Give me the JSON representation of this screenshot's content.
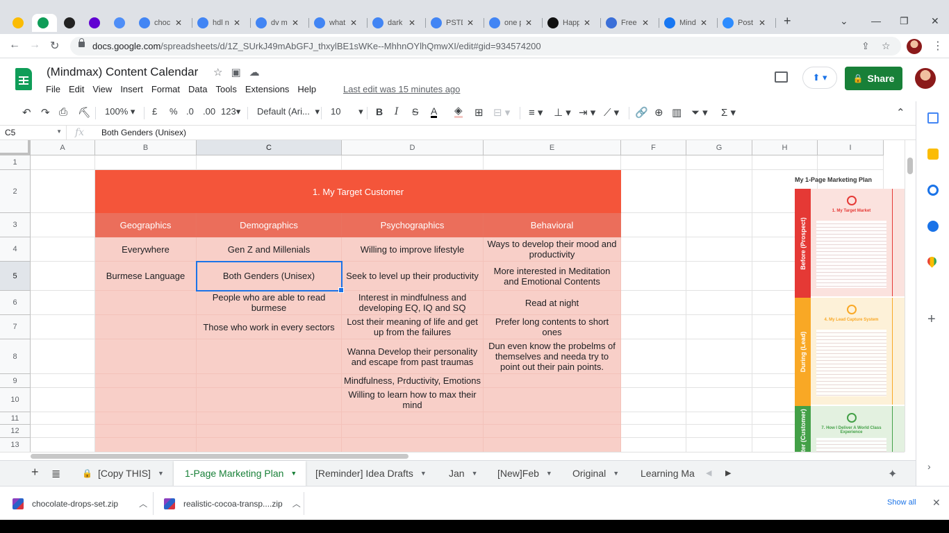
{
  "browser": {
    "tabs": [
      {
        "label": "",
        "icon": "google-drive-icon",
        "color": "#fbbc04"
      },
      {
        "label": "",
        "icon": "sheets-icon",
        "color": "#0f9d58",
        "active": true
      },
      {
        "label": "",
        "icon": "notion-icon",
        "color": "#222222"
      },
      {
        "label": "",
        "icon": "yahoo-icon",
        "color": "#6001d2"
      },
      {
        "label": "",
        "icon": "font-icon",
        "color": "#4f8ef7"
      },
      {
        "label": "choc",
        "icon": "google-icon",
        "color": "#4285f4"
      },
      {
        "label": "hdl n",
        "icon": "google-icon",
        "color": "#4285f4"
      },
      {
        "label": "dv m",
        "icon": "google-icon",
        "color": "#4285f4"
      },
      {
        "label": "what",
        "icon": "google-icon",
        "color": "#4285f4"
      },
      {
        "label": "dark",
        "icon": "google-icon",
        "color": "#4285f4"
      },
      {
        "label": "PSTD",
        "icon": "google-icon",
        "color": "#4285f4"
      },
      {
        "label": "one p",
        "icon": "google-icon",
        "color": "#4285f4"
      },
      {
        "label": "Happ",
        "icon": "happy-icon",
        "color": "#111111"
      },
      {
        "label": "Free",
        "icon": "star-icon",
        "color": "#3b6fd8"
      },
      {
        "label": "Mind",
        "icon": "facebook-icon",
        "color": "#1877f2"
      },
      {
        "label": "Post",
        "icon": "zoom-icon",
        "color": "#2d8cff"
      }
    ],
    "close_glyph": "✕",
    "new_tab_glyph": "+",
    "url_host": "docs.google.com",
    "url_path": "/spreadsheets/d/1Z_SUrkJ49mAbGFJ_thxylBE1sWKe--MhhnOYlhQmwXI/edit#gid=934574200"
  },
  "doc": {
    "title": "(Mindmax) Content Calendar",
    "menu": [
      "File",
      "Edit",
      "View",
      "Insert",
      "Format",
      "Data",
      "Tools",
      "Extensions",
      "Help"
    ],
    "last_edit": "Last edit was 15 minutes ago",
    "share_label": "Share"
  },
  "toolbar": {
    "zoom": "100%",
    "currency": "£",
    "percent": "%",
    "dec_decrease": ".0",
    "dec_increase": ".00",
    "number_format": "123",
    "font": "Default (Ari...",
    "font_size": "10",
    "bold": "B",
    "italic": "I",
    "strike": "S",
    "text_color": "A"
  },
  "formula_bar": {
    "cell_ref": "C5",
    "fx": "fx",
    "value": "Both Genders (Unisex)"
  },
  "grid": {
    "columns": [
      "A",
      "B",
      "C",
      "D",
      "E",
      "F",
      "G",
      "H",
      "I"
    ],
    "rows": [
      "1",
      "2",
      "3",
      "4",
      "5",
      "6",
      "7",
      "8",
      "9",
      "10",
      "11",
      "12",
      "13"
    ],
    "section_title": "1. My Target Customer",
    "headers": [
      "Geographics",
      "Demographics",
      "Psychographics",
      "Behavioral"
    ],
    "cells": {
      "B4": "Everywhere",
      "C4": "Gen Z and Millenials",
      "D4": "Willing to improve lifestyle",
      "E4": "Ways to develop their mood and productivity",
      "B5": "Burmese Language",
      "C5": "Both Genders (Unisex)",
      "D5": "Seek to level up their productivity",
      "E5": "More interested in Meditation and Emotional Contents",
      "C6": "People who are able to read burmese",
      "D6": "Interest in mindfulness and developing EQ, IQ and SQ",
      "E6": "Read at night",
      "C7": "Those who work in every sectors",
      "D7": "Lost their meaning of life and get up from the failures",
      "E7": "Prefer long contents to short ones",
      "D8": "Wanna Develop their personality and escape from past traumas",
      "E8": "Dun even know the probelms of themselves and needa try to point out their pain points.",
      "D9": "Mindfulness, Prductivity, Emotions",
      "D10": "Willing to learn how to max their mind"
    }
  },
  "thumbnail": {
    "title": "My 1-Page Marketing Plan",
    "bands": [
      {
        "label": "Before (Prospect)",
        "color": "#e53935"
      },
      {
        "label": "During (Lead)",
        "color": "#f9a825"
      },
      {
        "label": "After (Customer)",
        "color": "#43a047"
      }
    ],
    "panels": [
      {
        "title": "1. My Target Market",
        "bg": "#fbe2de",
        "color": "#e53935"
      },
      {
        "title": "4. My Lead Capture System",
        "bg": "#fdf1d8",
        "color": "#f9a825"
      },
      {
        "title": "7. How I Deliver A World Class Experience",
        "bg": "#e3f1e0",
        "color": "#43a047"
      }
    ]
  },
  "sheet_tabs": [
    {
      "label": "[Copy THIS]",
      "locked": true
    },
    {
      "label": "1-Page Marketing Plan",
      "active": true
    },
    {
      "label": "[Reminder] Idea Drafts"
    },
    {
      "label": "Jan"
    },
    {
      "label": "[New]Feb"
    },
    {
      "label": "Original"
    },
    {
      "label": "Learning Ma"
    }
  ],
  "downloads": {
    "items": [
      "chocolate-drops-set.zip",
      "realistic-cocoa-transp....zip"
    ],
    "show_all": "Show all"
  },
  "colors": {
    "accent_green": "#188038",
    "title_red": "#f4553a",
    "header_red": "#eb6e5b",
    "cell_pink": "#f8cfc8",
    "selection_blue": "#1a73e8"
  }
}
